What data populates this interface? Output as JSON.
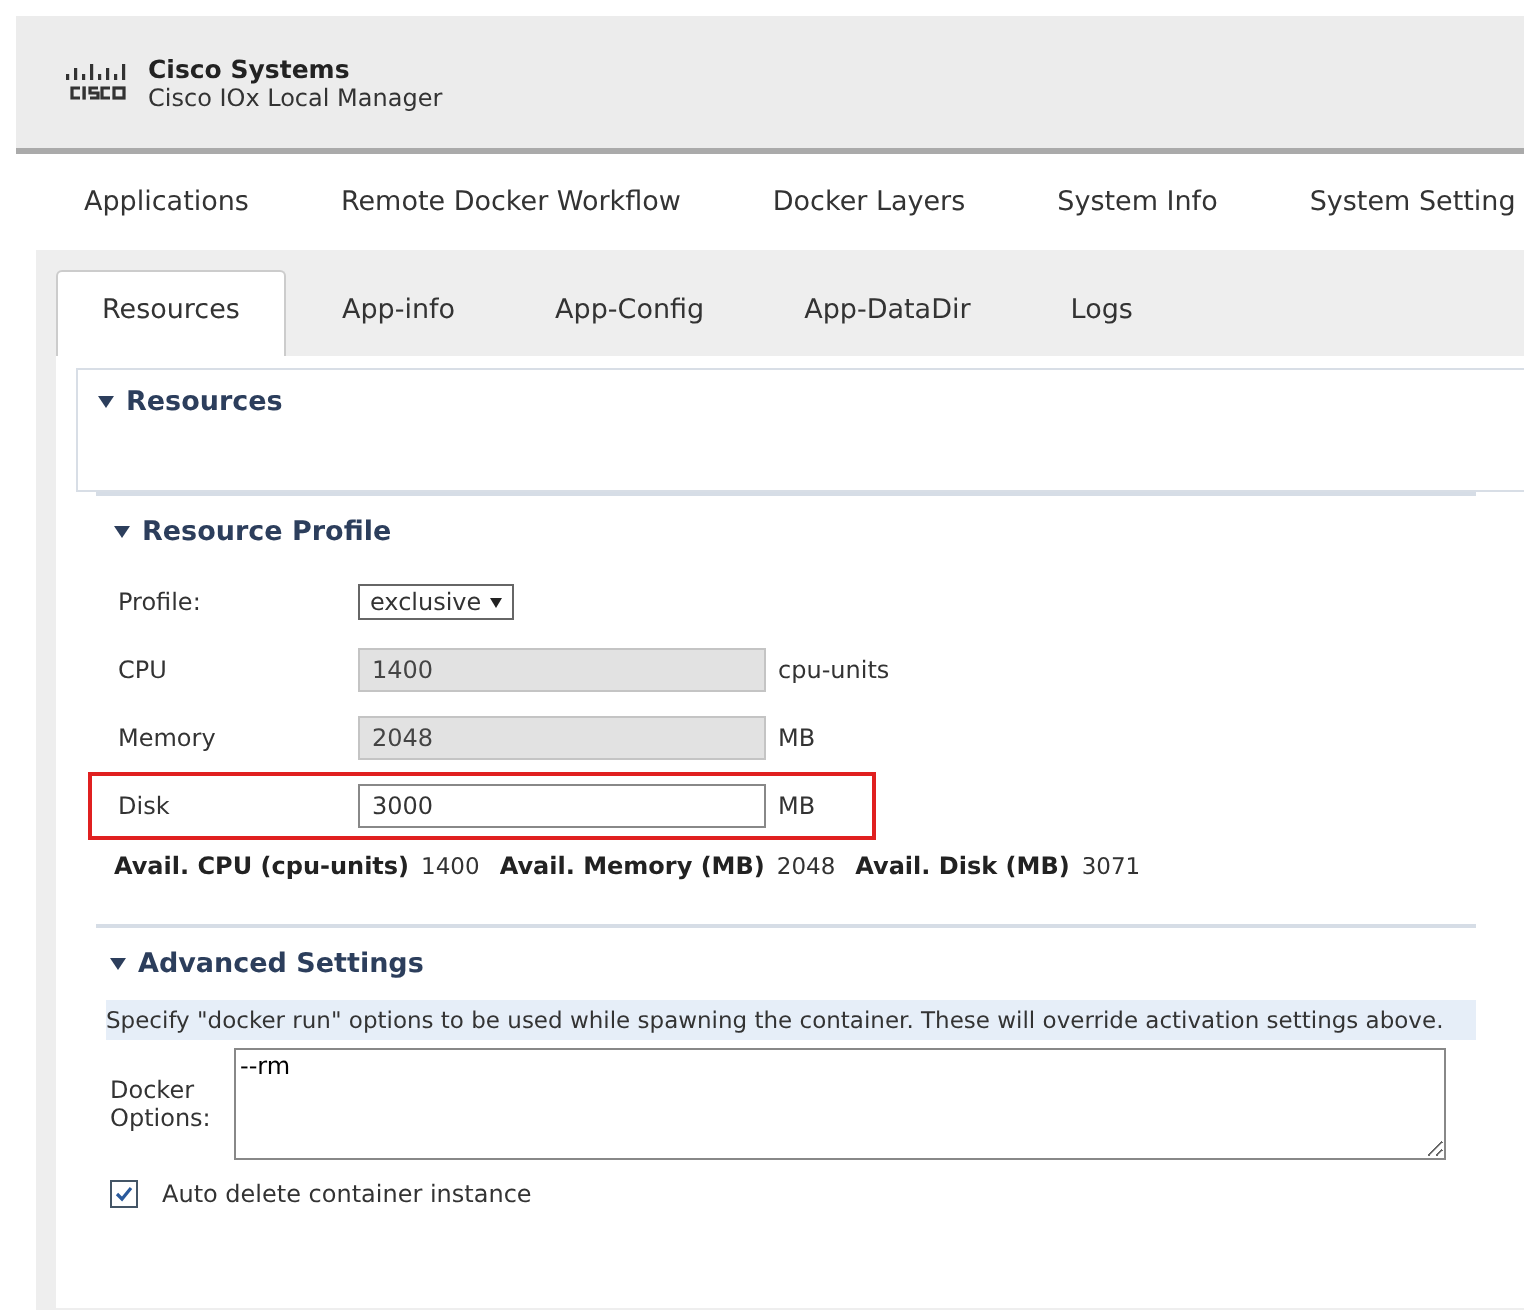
{
  "header": {
    "brand": "Cisco Systems",
    "product": "Cisco IOx Local Manager"
  },
  "nav": [
    {
      "label": "Applications",
      "selected": false
    },
    {
      "label": "Remote Docker Workflow",
      "selected": false
    },
    {
      "label": "Docker Layers",
      "selected": false
    },
    {
      "label": "System Info",
      "selected": false
    },
    {
      "label": "System Setting",
      "selected": false
    }
  ],
  "tabs": [
    {
      "label": "Resources",
      "selected": true
    },
    {
      "label": "App-info",
      "selected": false
    },
    {
      "label": "App-Config",
      "selected": false
    },
    {
      "label": "App-DataDir",
      "selected": false
    },
    {
      "label": "Logs",
      "selected": false
    }
  ],
  "resources_section": {
    "title": "Resources",
    "expanded": true
  },
  "resource_profile": {
    "title": "Resource Profile",
    "expanded": true,
    "fields": [
      {
        "kind": "select",
        "label": "Profile:",
        "value": "exclusive",
        "highlighted": false
      },
      {
        "kind": "input",
        "label": "CPU",
        "value": "1400",
        "unit": "cpu-units",
        "disabled": true,
        "highlighted": false
      },
      {
        "kind": "input",
        "label": "Memory",
        "value": "2048",
        "unit": "MB",
        "disabled": true,
        "highlighted": false
      },
      {
        "kind": "input",
        "label": "Disk",
        "value": "3000",
        "unit": "MB",
        "disabled": false,
        "highlighted": true
      }
    ],
    "availability": [
      {
        "label": "Avail. CPU (cpu-units)",
        "value": "1400"
      },
      {
        "label": "Avail. Memory (MB)",
        "value": "2048"
      },
      {
        "label": "Avail. Disk (MB)",
        "value": "3071"
      }
    ]
  },
  "advanced_settings": {
    "title": "Advanced Settings",
    "expanded": true,
    "hint": "Specify \"docker run\" options to be used while spawning the container. These will override activation settings above.",
    "docker_options": {
      "label": "Docker Options:",
      "value": "--rm"
    },
    "auto_delete": {
      "label": "Auto delete container instance",
      "checked": true
    }
  }
}
